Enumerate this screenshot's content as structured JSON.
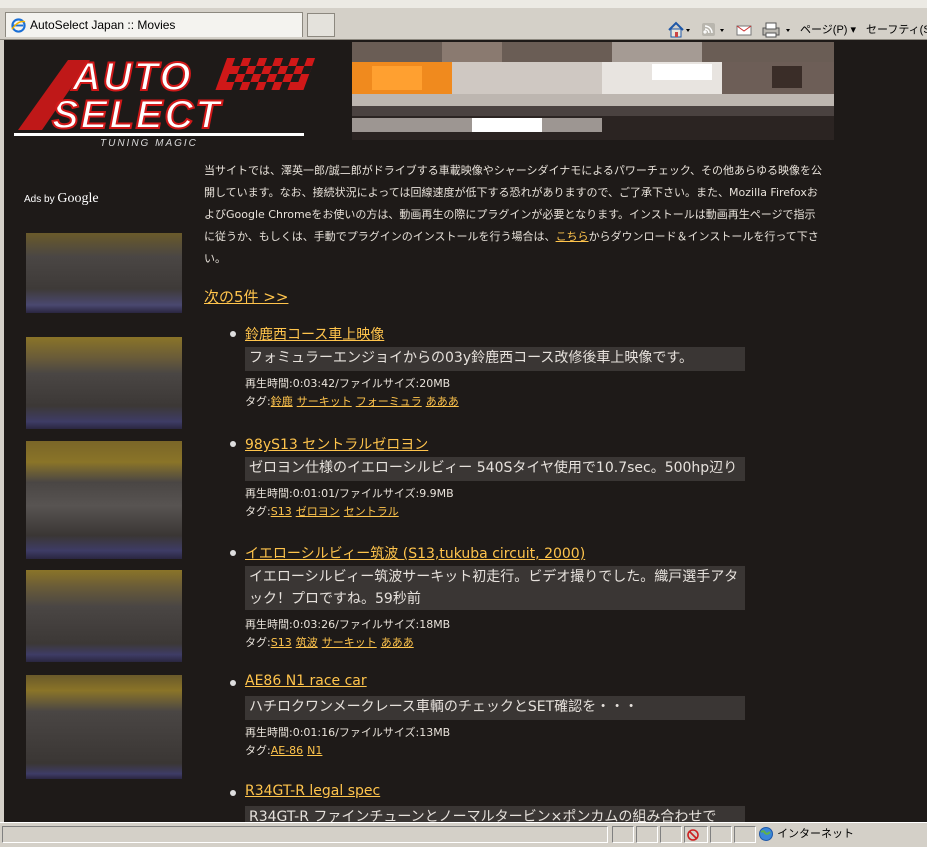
{
  "browser": {
    "tab_title": "AutoSelect Japan :: Movies",
    "page_menu": "ページ(P)",
    "safety_menu": "セーフティ(S)",
    "status_zone": "インターネット"
  },
  "site": {
    "logo_top": "AUTO",
    "logo_bottom": "SELECT",
    "logo_tagline": "TUNING MAGIC",
    "intro_text": "当サイトでは、澤英一郎/誠二郎がドライブする車載映像やシャーシダイナモによるパワーチェック、その他あらゆる映像を公開しています。なお、接続状況によっては回線速度が低下する恐れがありますので、ご了承下さい。また、Mozilla FirefoxおよびGoogle Chromeをお使いの方は、動画再生の際にプラグインが必要となります。インストールは動画再生ページで指示に従うか、もしくは、手動でプラグインのインストールを行う場合は、",
    "intro_link": "こちら",
    "intro_tail": "からダウンロード＆インストールを行って下さい。",
    "next_link": "次の5件 >>",
    "ads_label": "Ads by",
    "ads_brand": "Google",
    "tag_prefix": "タグ:"
  },
  "videos": [
    {
      "title": "鈴鹿西コース車上映像",
      "description": "フォミュラーエンジョイからの03y鈴鹿西コース改修後車上映像です。",
      "meta": "再生時間:0:03:42/ファイルサイズ:20MB",
      "tags": [
        "鈴鹿",
        "サーキット",
        "フォーミュラ",
        "あああ"
      ]
    },
    {
      "title": "98yS13 セントラルゼロヨン",
      "description": "ゼロヨン仕様のイエローシルビィー 540Sタイヤ使用で10.7sec。500hp辺り",
      "meta": "再生時間:0:01:01/ファイルサイズ:9.9MB",
      "tags": [
        "S13",
        "ゼロヨン",
        "セントラル"
      ]
    },
    {
      "title": "イエローシルビィー筑波 (S13,tukuba circuit, 2000)",
      "description": "イエローシルビィー筑波サーキット初走行。ビデオ撮りでした。織戸選手アタック！プロですね。59秒前",
      "meta": "再生時間:0:03:26/ファイルサイズ:18MB",
      "tags": [
        "S13",
        "筑波",
        "サーキット",
        "あああ"
      ]
    },
    {
      "title": "AE86 N1 race car",
      "description": "ハチロクワンメークレース車輌のチェックとSET確認を・・・",
      "meta": "再生時間:0:01:16/ファイルサイズ:13MB",
      "tags": [
        "AE-86",
        "N1"
      ]
    },
    {
      "title": "R34GT-R legal spec",
      "description": "R34GT-R ファインチューンとノーマルタービン×ポンカムの組み合わせで",
      "meta": "",
      "tags": []
    }
  ]
}
